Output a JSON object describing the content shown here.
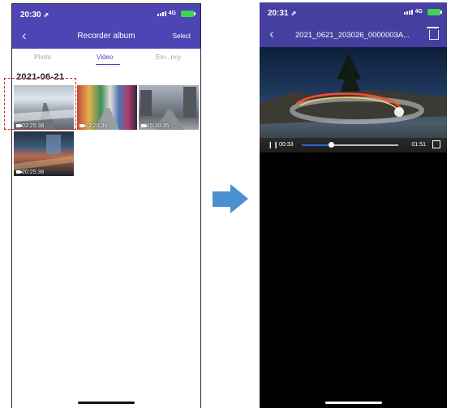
{
  "left": {
    "status": {
      "time": "20:30",
      "loc": "⇗",
      "network": "4G"
    },
    "navbar": {
      "back": "‹",
      "title": "Recorder album",
      "select": "Select"
    },
    "tabs": [
      {
        "label": "Photo",
        "active": false
      },
      {
        "label": "Video",
        "active": true
      },
      {
        "label": "Em...ncy",
        "active": false
      }
    ],
    "date_group": "2021-06-21",
    "videos": [
      {
        "duration": "02:25:38"
      },
      {
        "duration": "12:20:36"
      },
      {
        "duration": "15:30:36"
      },
      {
        "duration": "20:25:38"
      }
    ]
  },
  "right": {
    "status": {
      "time": "20:31",
      "loc": "⇗",
      "network": "4G"
    },
    "navbar": {
      "back": "‹",
      "title": "2021_0621_203026_0000003A..."
    },
    "player": {
      "pause": "❙❙",
      "current_time": "00:33",
      "total_time": "01:51",
      "progress": 0.3
    }
  },
  "colors": {
    "accent": "#4d45b3",
    "progress": "#2f62d6",
    "highlight": "#d32a2a",
    "arrow": "#4a8fd0"
  }
}
